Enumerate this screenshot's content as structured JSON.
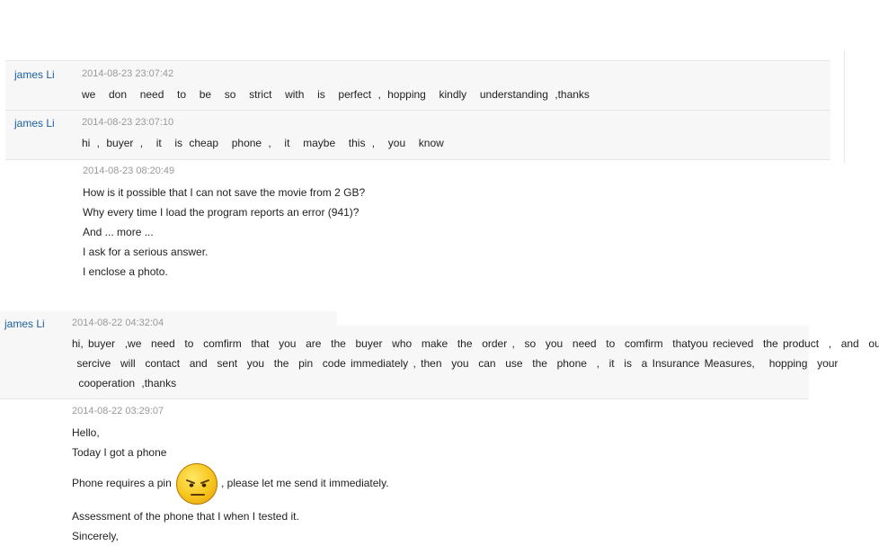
{
  "messages": [
    {
      "author": "james Li",
      "time": "2014-08-23 23:07:42",
      "lines": [
        "we  don  need  to  be  so  strict  with  is  perfect , hopping  kindly  understanding ,thanks"
      ]
    },
    {
      "author": "james Li",
      "time": "2014-08-23 23:07:10",
      "lines": [
        "hi , buyer ,  it  is cheap  phone ,  it  maybe  this ,  you  know"
      ]
    },
    {
      "author": "",
      "time": "2014-08-23 08:20:49",
      "lines": [
        "How is it possible that I can not save the movie from 2 GB?",
        "Why every time I load the program reports an error (941)?",
        "And ... more ...",
        "I ask for a serious answer.",
        "I enclose a photo."
      ]
    },
    {
      "author": "james Li",
      "time": "2014-08-22 04:32:04",
      "lines": [
        "hi, buyer  ,we  need  to  comfirm  that  you  are  the  buyer  who  make  the  order ,  so  you  need  to  comfirm  thatyou recieved  the product  ,  and  our",
        " sercive  will  contact  and  sent  you  the  pin  code immediately , then  you  can  use  the  phone  ,  it  is  a Insurance Measures,   hopping  your",
        " cooperation ,thanks"
      ]
    },
    {
      "author": "",
      "time": "2014-08-22 03:29:07",
      "lines": [
        "Hello,",
        "Today I got a phone",
        "Phone requires a pin",
        ", please let me send it immediately.",
        "Assessment of the phone that I when I tested it.",
        "Sincerely,"
      ]
    }
  ],
  "emoticon": "frowning-face-emoticon"
}
